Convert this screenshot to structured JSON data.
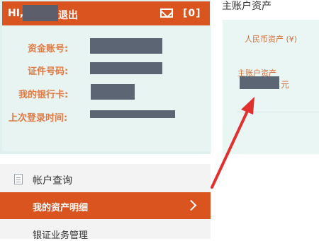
{
  "header": {
    "greeting": "HI,",
    "logout": "退出",
    "msg_count": "[0]"
  },
  "account_info": [
    {
      "label": "资金账号:"
    },
    {
      "label": "证件号码:"
    },
    {
      "label": "我的银行卡:"
    },
    {
      "label": "上次登录时间:"
    }
  ],
  "menu": {
    "section_title": "帐户查询",
    "active_item": "我的资产明细",
    "next_item": "银证业务管理"
  },
  "assets_panel": {
    "title": "主账户资产",
    "rmb_label": "人民币资产 (¥)",
    "main_label": "主账户资产",
    "unit": "元"
  },
  "colors": {
    "accent": "#d9541f",
    "label_text": "#e07a44",
    "arrow": "#e03030"
  }
}
